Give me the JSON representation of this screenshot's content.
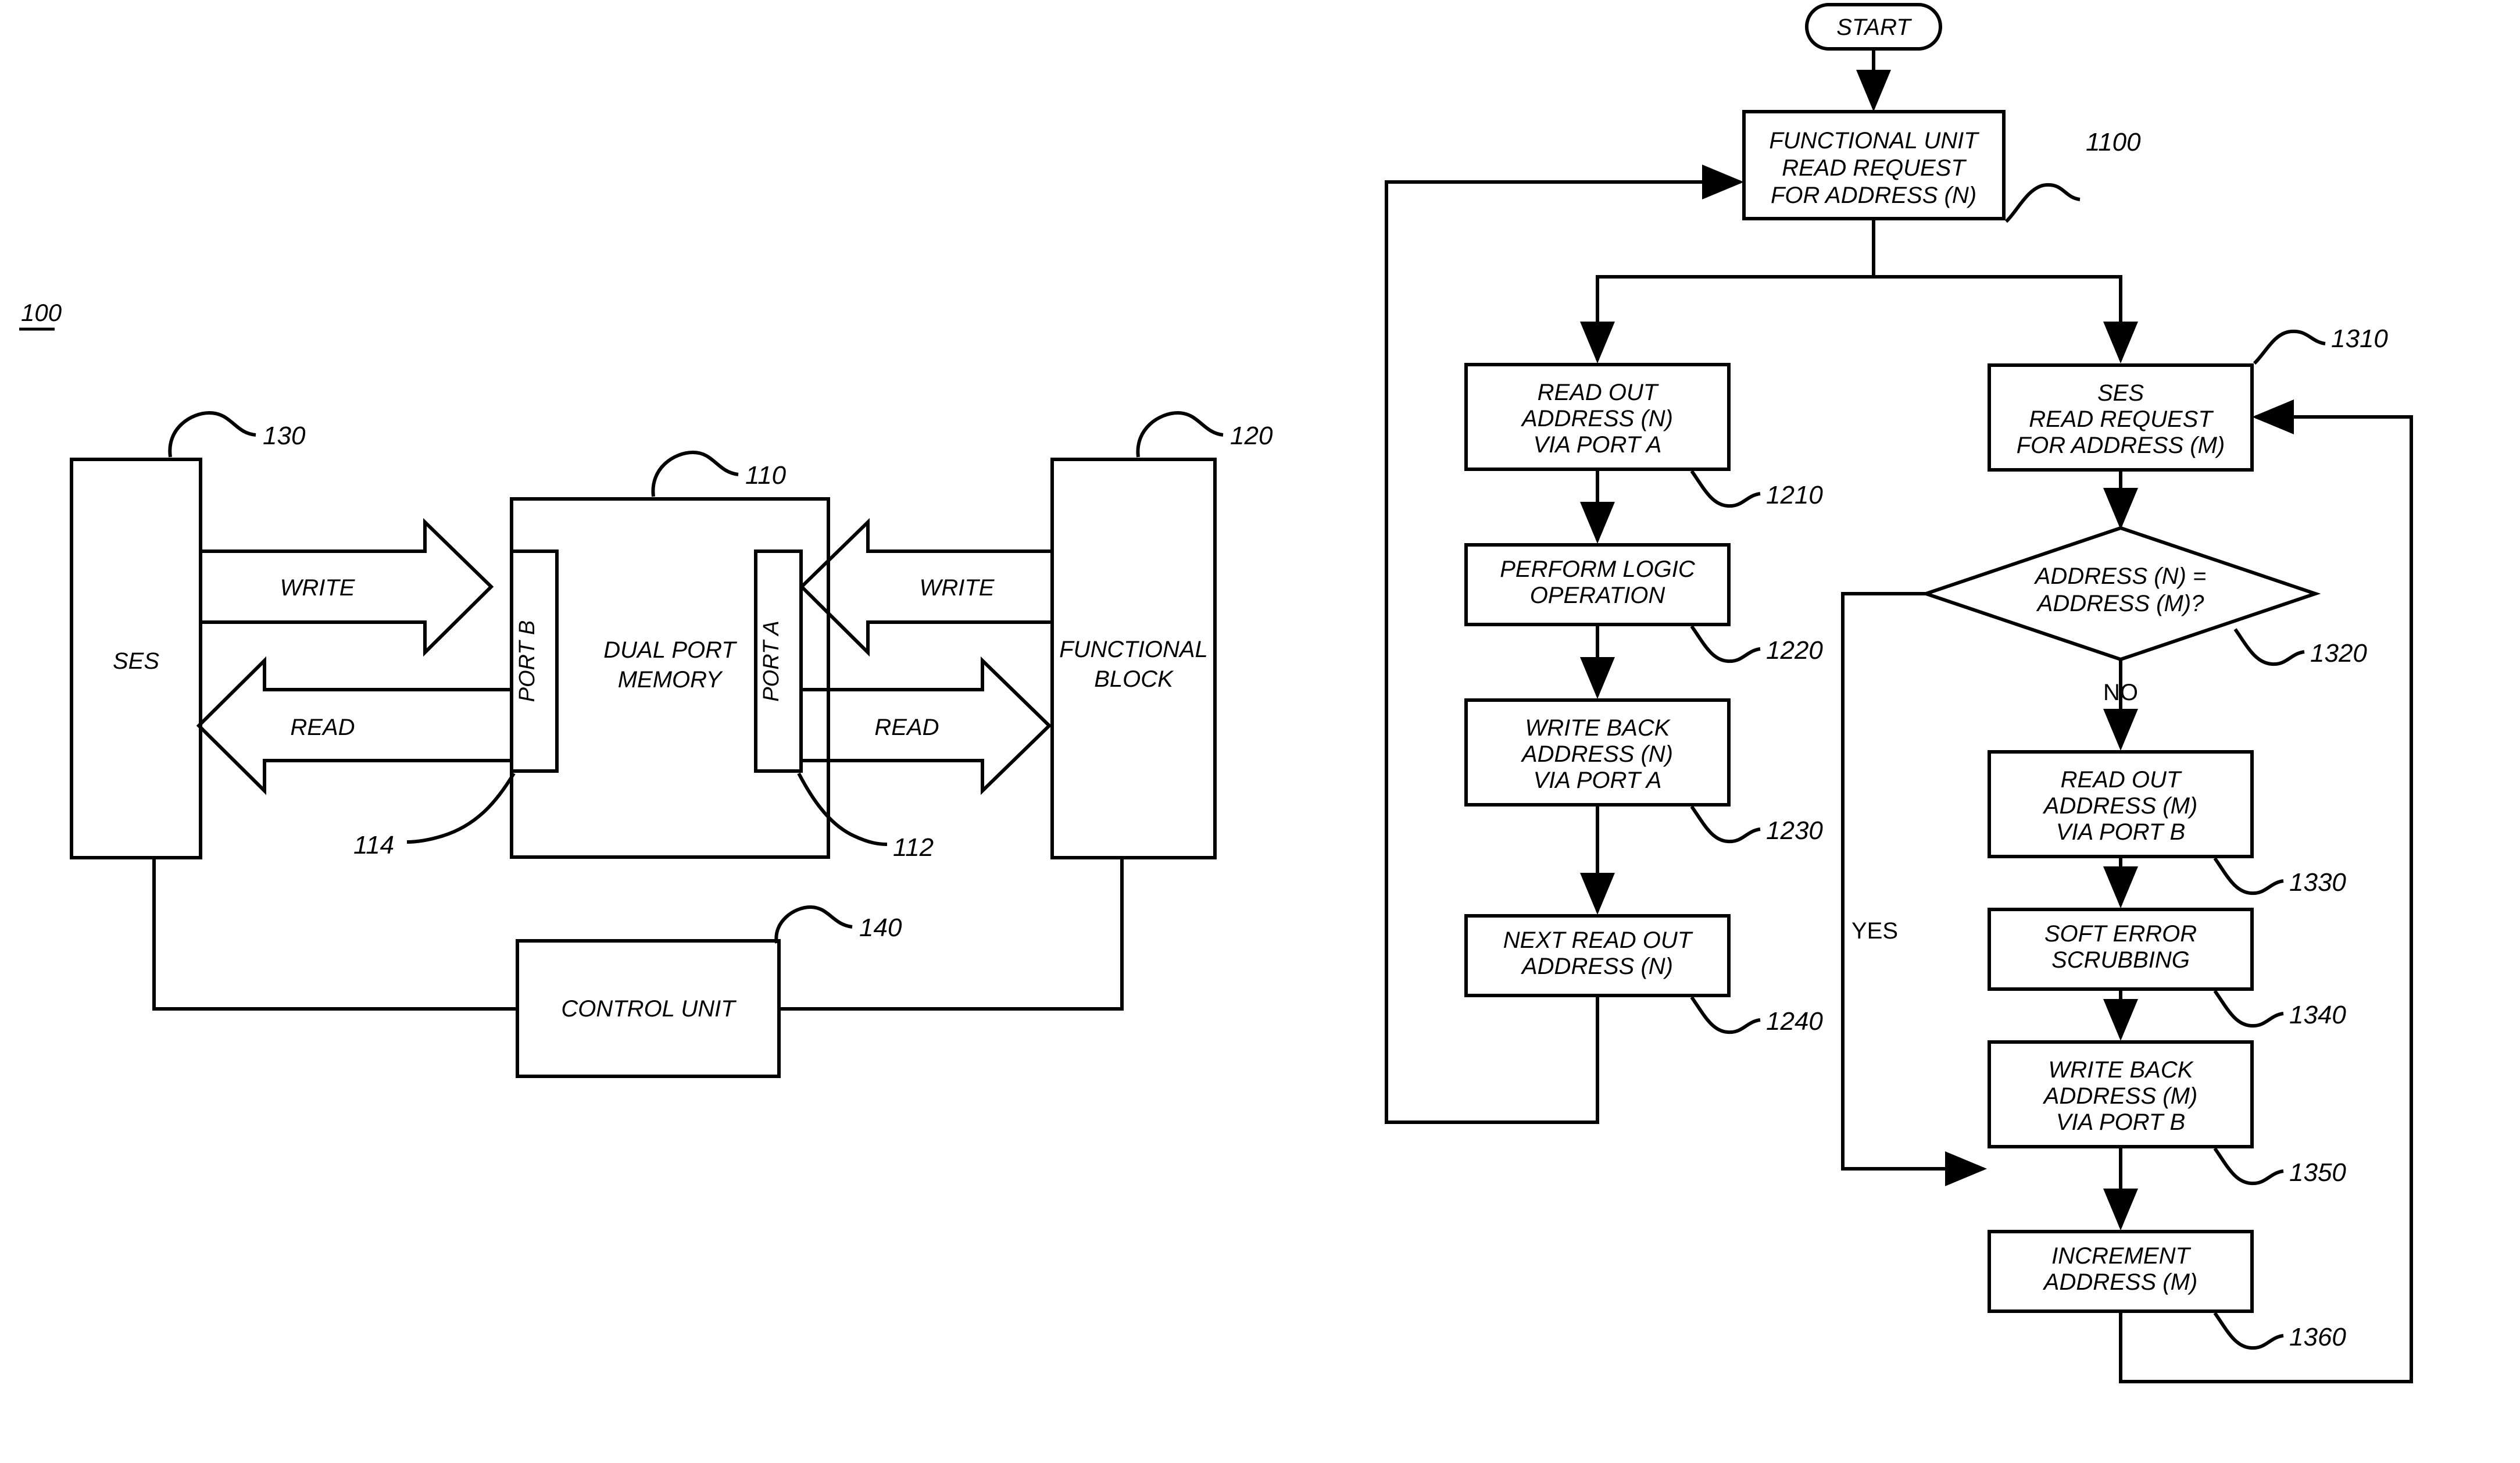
{
  "figure_left": {
    "figure_ref": "100",
    "blocks": [
      {
        "id": "ses",
        "label": "SES",
        "ref": "130"
      },
      {
        "id": "dual_port_mem",
        "label_line1": "DUAL PORT",
        "label_line2": "MEMORY",
        "ref": "110"
      },
      {
        "id": "port_b",
        "label": "PORT B",
        "ref": "114"
      },
      {
        "id": "port_a",
        "label": "PORT A",
        "ref": "112"
      },
      {
        "id": "functional_block",
        "label_line1": "FUNCTIONAL",
        "label_line2": "BLOCK",
        "ref": "120"
      },
      {
        "id": "control_unit",
        "label": "CONTROL UNIT",
        "ref": "140"
      }
    ],
    "arrows": [
      {
        "id": "ses-write",
        "label": "WRITE",
        "direction": "right"
      },
      {
        "id": "ses-read",
        "label": "READ",
        "direction": "left"
      },
      {
        "id": "fb-write",
        "label": "WRITE",
        "direction": "left"
      },
      {
        "id": "fb-read",
        "label": "READ",
        "direction": "right"
      }
    ]
  },
  "figure_right": {
    "terminator": {
      "label": "START"
    },
    "steps": [
      {
        "id": "s1100",
        "ref": "1100",
        "lines": [
          "FUNCTIONAL UNIT",
          "READ REQUEST",
          "FOR ADDRESS (N)"
        ]
      },
      {
        "id": "s1210",
        "ref": "1210",
        "lines": [
          "READ OUT",
          "ADDRESS (N)",
          "VIA PORT A"
        ]
      },
      {
        "id": "s1220",
        "ref": "1220",
        "lines": [
          "PERFORM LOGIC",
          "OPERATION"
        ]
      },
      {
        "id": "s1230",
        "ref": "1230",
        "lines": [
          "WRITE BACK",
          "ADDRESS (N)",
          "VIA PORT A"
        ]
      },
      {
        "id": "s1240",
        "ref": "1240",
        "lines": [
          "NEXT READ OUT",
          "ADDRESS (N)"
        ]
      },
      {
        "id": "s1310",
        "ref": "1310",
        "lines": [
          "SES",
          "READ REQUEST",
          "FOR ADDRESS (M)"
        ]
      },
      {
        "id": "s1320",
        "ref": "1320",
        "lines": [
          "ADDRESS (N) =",
          "ADDRESS (M)?"
        ],
        "shape": "decision"
      },
      {
        "id": "s1330",
        "ref": "1330",
        "lines": [
          "READ OUT",
          "ADDRESS (M)",
          "VIA PORT B"
        ]
      },
      {
        "id": "s1340",
        "ref": "1340",
        "lines": [
          "SOFT ERROR",
          "SCRUBBING"
        ]
      },
      {
        "id": "s1350",
        "ref": "1350",
        "lines": [
          "WRITE BACK",
          "ADDRESS (M)",
          "VIA PORT B"
        ]
      },
      {
        "id": "s1360",
        "ref": "1360",
        "lines": [
          "INCREMENT",
          "ADDRESS (M)"
        ]
      }
    ],
    "branch_labels": {
      "no": "NO",
      "yes": "YES"
    }
  },
  "style": {
    "stroke": "#000000",
    "background": "#ffffff"
  }
}
